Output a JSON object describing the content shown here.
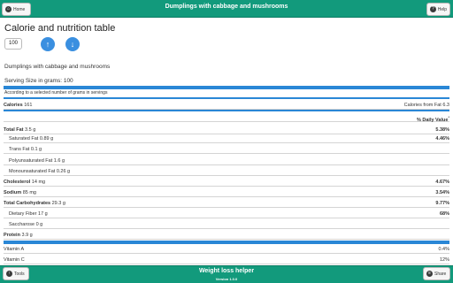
{
  "header": {
    "title": "Dumplings with cabbage and mushrooms",
    "home_label": "Home",
    "help_label": "Help"
  },
  "main": {
    "page_title": "Calorie and nutrition table",
    "grams_value": "100",
    "dish_name": "Dumplings with cabbage and mushrooms",
    "serving_size": "Serving Size in grams: 100",
    "serving_note": "According to a selected number of grams in servings",
    "calories_label": "Calories",
    "calories_value": "161",
    "calories_fat": "Calories from Fat 6.3",
    "daily_value_header": "% Daily Value",
    "daily_value_mark": "*",
    "nutrients": [
      {
        "name": "Total Fat",
        "amount": "3.5 g",
        "dv": "5.38%"
      },
      {
        "name": "Saturated Fat",
        "amount": "0.89 g",
        "dv": "4.46%"
      },
      {
        "name": "Trans Fat",
        "amount": "0.1 g",
        "dv": ""
      },
      {
        "name": "Polyunsaturated Fat",
        "amount": "1.6 g",
        "dv": ""
      },
      {
        "name": "Monounsaturated Fat",
        "amount": "0.26 g",
        "dv": ""
      },
      {
        "name": "Cholesterol",
        "amount": "14 mg",
        "dv": "4.67%"
      },
      {
        "name": "Sodium",
        "amount": "85 mg",
        "dv": "3.54%"
      },
      {
        "name": "Total Carbohydrates",
        "amount": "29.3 g",
        "dv": "9.77%"
      },
      {
        "name": "Dietary Fiber",
        "amount": "17 g",
        "dv": "68%"
      },
      {
        "name": "Saccharose",
        "amount": "0 g",
        "dv": ""
      },
      {
        "name": "Protein",
        "amount": "3.9 g",
        "dv": ""
      },
      {
        "name": "Vitamin A",
        "amount": "",
        "dv": "0.4%"
      },
      {
        "name": "Vitamin C",
        "amount": "",
        "dv": "12%"
      }
    ]
  },
  "footer": {
    "title": "Weight loss helper",
    "version": "Version 1.0.0",
    "tools_label": "Tools",
    "share_label": "Share"
  },
  "colors": {
    "brand": "#129a7c",
    "accent": "#2a87d6"
  },
  "icons": {
    "home": "home-icon",
    "help": "help-icon",
    "tools": "tools-icon",
    "share": "share-icon",
    "up": "arrow-up-icon",
    "down": "arrow-down-icon"
  }
}
